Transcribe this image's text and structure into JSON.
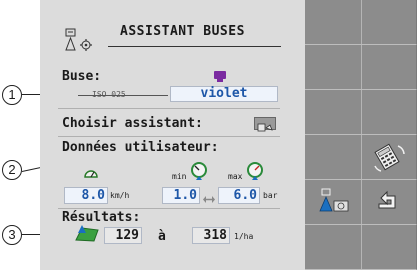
{
  "header": {
    "title": "ASSISTANT BUSES"
  },
  "buse": {
    "label": "Buse:",
    "crossed_value": "ISO 025",
    "color_value": "violet",
    "color_swatch": "#7a2aa0"
  },
  "assistant": {
    "label": "Choisir assistant:"
  },
  "user_data": {
    "label": "Données utilisateur:",
    "min_label": "min",
    "max_label": "max",
    "speed_value": "8.0",
    "speed_unit": "km/h",
    "pressure_min": "1.0",
    "pressure_max": "6.0",
    "pressure_unit": "bar"
  },
  "results": {
    "label": "Résultats:",
    "from_value": "129",
    "to_word": "à",
    "to_value": "318",
    "unit": "1/ha"
  },
  "callouts": [
    "1",
    "2",
    "3"
  ],
  "colors": {
    "accent_blue": "#1e57a8",
    "nozzle_blue": "#1a6fc0",
    "green": "#3aa040"
  }
}
